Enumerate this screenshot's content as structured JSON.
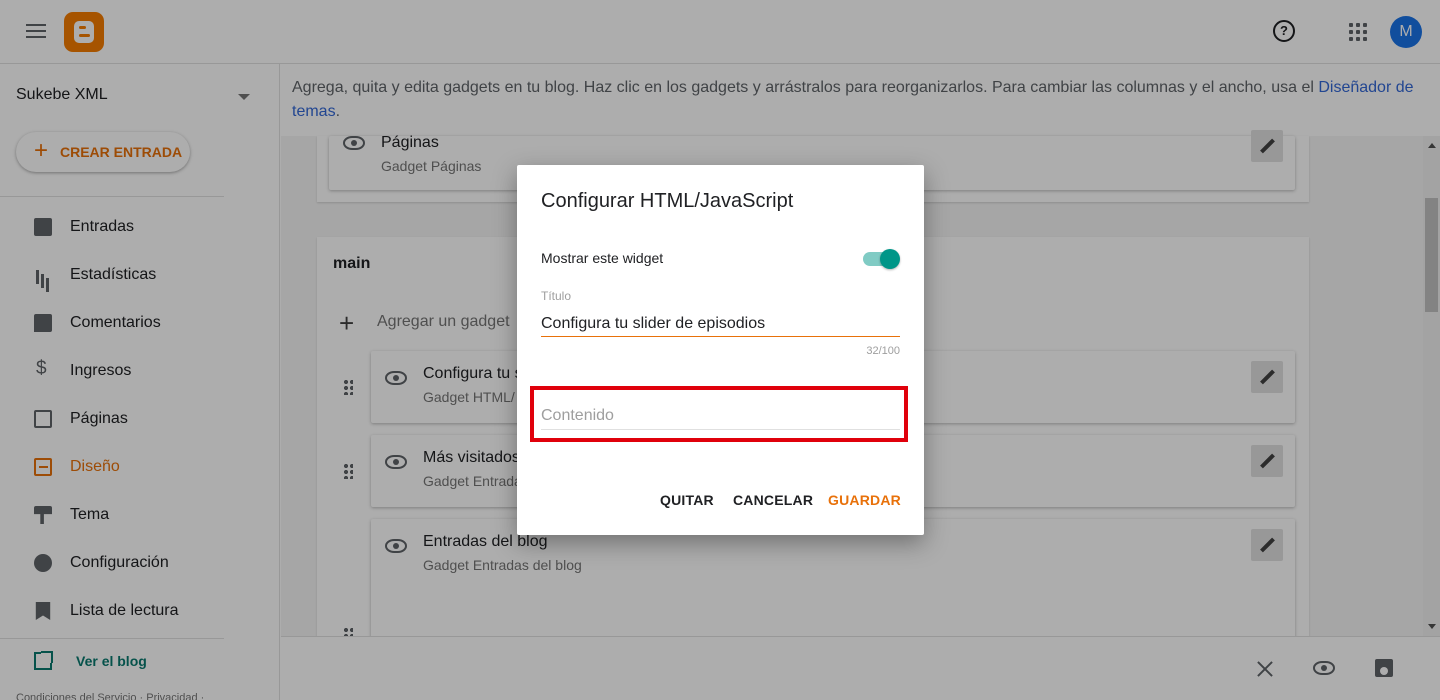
{
  "header": {
    "menu_icon": "hamburger-menu-icon",
    "logo_icon": "blogger-logo-icon",
    "help_icon": "help-circle-icon",
    "apps_icon": "apps-grid-icon",
    "avatar_initial": "M",
    "avatar_color": "#1a73e8"
  },
  "sidebar": {
    "blog_name": "Sukebe XML",
    "create_button": "CREAR ENTRADA",
    "items": [
      {
        "label": "Entradas",
        "icon": "posts-icon",
        "active": false
      },
      {
        "label": "Estadísticas",
        "icon": "stats-icon",
        "active": false
      },
      {
        "label": "Comentarios",
        "icon": "comment-icon",
        "active": false
      },
      {
        "label": "Ingresos",
        "icon": "dollar-icon",
        "active": false
      },
      {
        "label": "Páginas",
        "icon": "pages-icon",
        "active": false
      },
      {
        "label": "Diseño",
        "icon": "layout-icon",
        "active": true
      },
      {
        "label": "Tema",
        "icon": "paint-roller-icon",
        "active": false
      },
      {
        "label": "Configuración",
        "icon": "gear-icon",
        "active": false
      },
      {
        "label": "Lista de lectura",
        "icon": "bookmark-icon",
        "active": false
      }
    ],
    "view_blog": "Ver el blog",
    "footer": "Condiciones del Servicio · Privacidad ·",
    "accent_color": "#e8710a"
  },
  "main": {
    "info_text": "Agrega, quita y edita gadgets en tu blog. Haz clic en los gadgets y arrástralos para reorganizarlos. Para cambiar las columnas y el ancho, usa el ",
    "info_link": "Diseñador de temas",
    "info_end": ".",
    "top_gadget": {
      "title": "Páginas",
      "subtitle": "Gadget Páginas"
    },
    "section_title": "main",
    "add_gadget": "Agregar un gadget",
    "gadgets": [
      {
        "title": "Configura tu s",
        "subtitle": "Gadget HTML/"
      },
      {
        "title": "Más visitados",
        "subtitle": "Gadget Entrada"
      },
      {
        "title": "Entradas del blog",
        "subtitle": "Gadget Entradas del blog"
      }
    ]
  },
  "bottom_bar": {
    "close_icon": "close-icon",
    "preview_icon": "eye-icon",
    "save_icon": "save-icon"
  },
  "dialog": {
    "title": "Configurar HTML/JavaScript",
    "toggle_label": "Mostrar este widget",
    "toggle_on": true,
    "title_field_label": "Título",
    "title_field_value": "Configura tu slider de episodios",
    "title_counter": "32/100",
    "content_placeholder": "Contenido",
    "buttons": {
      "quit": "QUITAR",
      "cancel": "CANCELAR",
      "save": "GUARDAR"
    },
    "highlight_color": "#e0000b"
  }
}
